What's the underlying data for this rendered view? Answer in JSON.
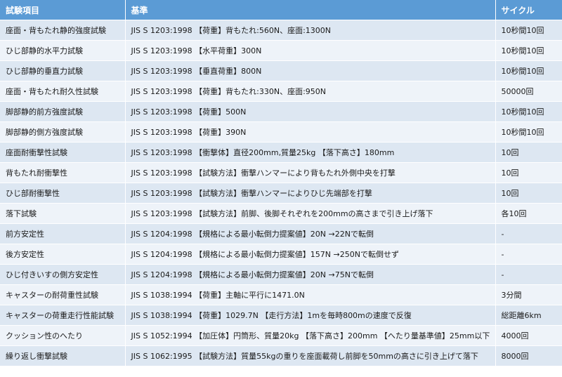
{
  "table": {
    "headers": [
      "試験項目",
      "基準",
      "サイクル"
    ],
    "rows": [
      [
        "座面・背もたれ静的強度試験",
        "JIS S 1203:1998 【荷重】背もたれ:560N、座面:1300N",
        "10秒間10回"
      ],
      [
        "ひじ部静的水平力試験",
        "JIS S 1203:1998 【水平荷重】300N",
        "10秒間10回"
      ],
      [
        "ひじ部静的垂直力試験",
        "JIS S 1203:1998 【垂直荷重】800N",
        "10秒間10回"
      ],
      [
        "座面・背もたれ耐久性試験",
        "JIS S 1203:1998 【荷重】背もたれ:330N、座面:950N",
        "50000回"
      ],
      [
        "脚部静的前方強度試験",
        "JIS S 1203:1998 【荷重】500N",
        "10秒間10回"
      ],
      [
        "脚部静的側方強度試験",
        "JIS S 1203:1998 【荷重】390N",
        "10秒間10回"
      ],
      [
        "座面耐衝撃性試験",
        "JIS S 1203:1998 【衝撃体】直径200mm,質量25kg 【落下高さ】180mm",
        "10回"
      ],
      [
        "背もたれ耐衝撃性",
        "JIS S 1203:1998 【試験方法】衝撃ハンマーにより背もたれ外側中央を打撃",
        "10回"
      ],
      [
        "ひじ部耐衝撃性",
        "JIS S 1203:1998 【試験方法】衝撃ハンマーによりひじ先端部を打撃",
        "10回"
      ],
      [
        "落下試験",
        "JIS S 1203:1998 【試験方法】前脚、後脚それぞれを200mmの高さまで引き上げ落下",
        "各10回"
      ],
      [
        "前方安定性",
        "JIS S 1204:1998 【規格による最小転倒力提案値】20N →22Nで転倒",
        "-"
      ],
      [
        "後方安定性",
        "JIS S 1204:1998 【規格による最小転倒力提案値】157N →250Nで転倒せず",
        "-"
      ],
      [
        "ひじ付きいすの側方安定性",
        "JIS S 1204:1998 【規格による最小転倒力提案値】20N →75Nで転倒",
        "-"
      ],
      [
        "キャスターの耐荷重性試験",
        "JIS S 1038:1994 【荷重】主軸に平行に1471.0N",
        "3分間"
      ],
      [
        "キャスターの荷重走行性能試験",
        "JIS S 1038:1994 【荷重】1029.7N 【走行方法】1mを毎時800mの速度で反復",
        "総距離6km"
      ],
      [
        "クッション性のへたり",
        "JIS S 1052:1994 【加圧体】円筒形、質量20kg 【落下高さ】200mm 【へたり量基準値】25mm以下",
        "4000回"
      ],
      [
        "繰り返し衝撃試験",
        "JIS S 1062:1995 【試験方法】質量55kgの重りを座面載荷し前脚を50mmの高さに引き上げて落下",
        "8000回"
      ]
    ]
  }
}
